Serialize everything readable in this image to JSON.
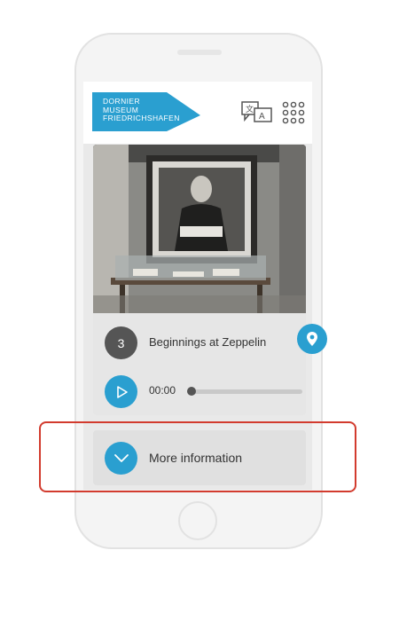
{
  "header": {
    "logo_lines": "DORNIER\nMUSEUM\nFRIEDRICHSHAFEN",
    "logo_color": "#2a9fd0",
    "icons": [
      "translate-icon",
      "app-grid-icon"
    ]
  },
  "stop": {
    "number": "3",
    "title": "Beginnings at Zeppelin",
    "photo_description_icon": "exhibit-photo"
  },
  "player": {
    "time": "00:00",
    "progress": 0,
    "accent": "#2a9fd0"
  },
  "more": {
    "label": "More information"
  },
  "colors": {
    "accent": "#2a9fd0",
    "highlight": "#d23b2e"
  }
}
